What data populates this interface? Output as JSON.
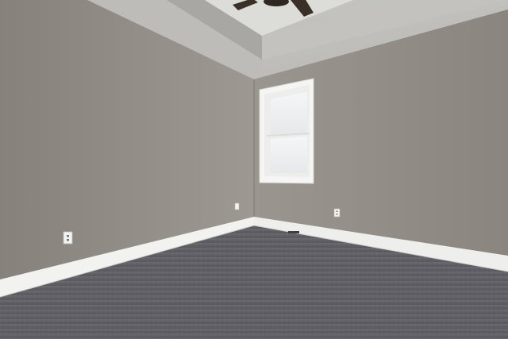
{
  "scene": {
    "subject": "empty-bedroom",
    "objects": [
      "tray-ceiling",
      "ceiling-fan",
      "window",
      "left-wall",
      "back-wall",
      "baseboards",
      "electrical-outlets",
      "carpet-floor"
    ]
  },
  "colors": {
    "wall_left": "#8f8a84",
    "wall_back": "#958f89",
    "ceiling": "#cfcfcc",
    "trim": "#f4f4f2",
    "carpet": "#5f5e63",
    "fan": "#3a3028"
  }
}
